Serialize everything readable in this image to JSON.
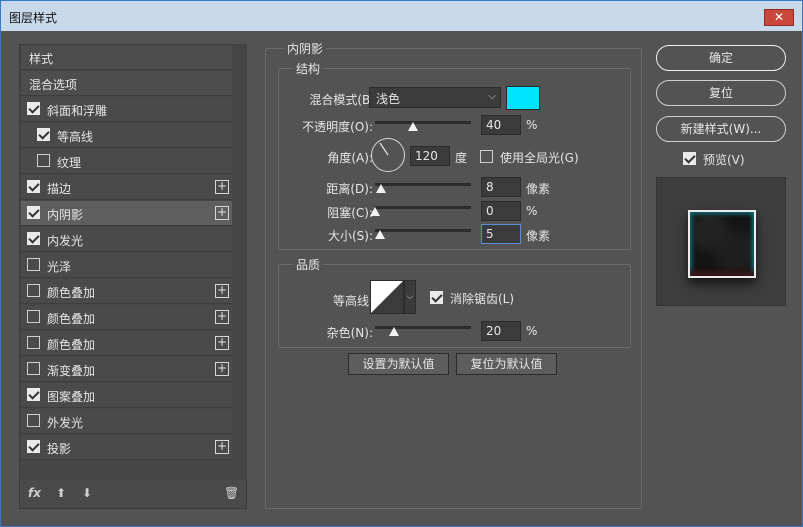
{
  "window": {
    "title": "图层样式",
    "close_glyph": "✕"
  },
  "styles_panel": {
    "items": [
      {
        "label": "样式",
        "type": "header",
        "checked": null,
        "plus": false,
        "indent": 0
      },
      {
        "label": "混合选项",
        "type": "header",
        "checked": null,
        "plus": false,
        "indent": 0
      },
      {
        "label": "斜面和浮雕",
        "type": "effect",
        "checked": true,
        "plus": false,
        "indent": 0
      },
      {
        "label": "等高线",
        "type": "effect",
        "checked": true,
        "plus": false,
        "indent": 1
      },
      {
        "label": "纹理",
        "type": "effect",
        "checked": false,
        "plus": false,
        "indent": 1
      },
      {
        "label": "描边",
        "type": "effect",
        "checked": true,
        "plus": true,
        "indent": 0
      },
      {
        "label": "内阴影",
        "type": "effect",
        "checked": true,
        "plus": true,
        "indent": 0,
        "selected": true
      },
      {
        "label": "内发光",
        "type": "effect",
        "checked": true,
        "plus": false,
        "indent": 0
      },
      {
        "label": "光泽",
        "type": "effect",
        "checked": false,
        "plus": false,
        "indent": 0
      },
      {
        "label": "颜色叠加",
        "type": "effect",
        "checked": false,
        "plus": true,
        "indent": 0
      },
      {
        "label": "颜色叠加",
        "type": "effect",
        "checked": false,
        "plus": true,
        "indent": 0
      },
      {
        "label": "颜色叠加",
        "type": "effect",
        "checked": false,
        "plus": true,
        "indent": 0
      },
      {
        "label": "渐变叠加",
        "type": "effect",
        "checked": false,
        "plus": true,
        "indent": 0
      },
      {
        "label": "图案叠加",
        "type": "effect",
        "checked": true,
        "plus": false,
        "indent": 0
      },
      {
        "label": "外发光",
        "type": "effect",
        "checked": false,
        "plus": false,
        "indent": 0
      },
      {
        "label": "投影",
        "type": "effect",
        "checked": true,
        "plus": true,
        "indent": 0
      }
    ],
    "footer": {
      "fx": "fx",
      "up": "⬆",
      "down": "⬇",
      "trash": "🗑"
    },
    "plus_glyph": "+"
  },
  "inner_shadow": {
    "title": "内阴影",
    "structure": {
      "title": "结构",
      "blend_mode_label": "混合模式(B):",
      "blend_mode_value": "浅色",
      "color": "#00e5ff",
      "opacity_label": "不透明度(O):",
      "opacity_value": "40",
      "opacity_unit": "%",
      "angle_label": "角度(A):",
      "angle_value": "120",
      "angle_unit": "度",
      "global_light_label": "使用全局光(G)",
      "global_light_checked": false,
      "distance_label": "距离(D):",
      "distance_value": "8",
      "distance_unit": "像素",
      "choke_label": "阻塞(C):",
      "choke_value": "0",
      "choke_unit": "%",
      "size_label": "大小(S):",
      "size_value": "5",
      "size_unit": "像素"
    },
    "quality": {
      "title": "品质",
      "contour_label": "等高线:",
      "anti_alias_label": "消除锯齿(L)",
      "anti_alias_checked": true,
      "noise_label": "杂色(N):",
      "noise_value": "20",
      "noise_unit": "%"
    },
    "set_default_label": "设置为默认值",
    "reset_default_label": "复位为默认值"
  },
  "right_panel": {
    "ok_label": "确定",
    "reset_label": "复位",
    "new_style_label": "新建样式(W)...",
    "preview_label": "预览(V)",
    "preview_checked": true
  }
}
